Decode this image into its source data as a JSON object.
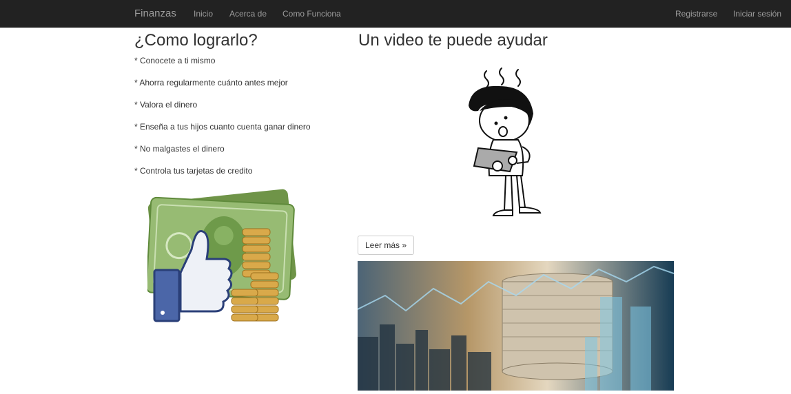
{
  "navbar": {
    "brand": "Finanzas",
    "links": [
      "Inicio",
      "Acerca de",
      "Como Funciona"
    ],
    "right_links": [
      "Registrarse",
      "Iniciar sesión"
    ]
  },
  "left": {
    "title": "¿Como lograrlo?",
    "tips": [
      "* Conocete a ti mismo",
      "* Ahorra regularmente cuánto antes mejor",
      "* Valora el dinero",
      "* Enseña a tus hijos cuanto cuenta ganar dinero",
      "* No malgastes el dinero",
      "* Controla tus tarjetas de credito"
    ]
  },
  "right": {
    "title": "Un video te puede ayudar",
    "read_more": "Leer más »"
  },
  "colors": {
    "navbar_bg": "#222222",
    "nav_text": "#9d9d9d",
    "money_green": "#8fb369",
    "coin_gold": "#d9a94a",
    "thumb_blue": "#4b66a8"
  }
}
